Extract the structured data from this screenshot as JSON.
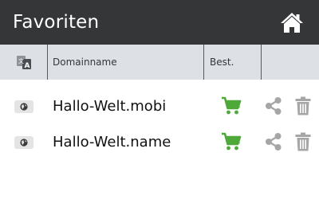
{
  "header": {
    "title": "Favoriten",
    "home_icon": "home-icon"
  },
  "table": {
    "columns": {
      "language_icon": "language-translate-icon",
      "domain": "Domainname",
      "order": "Best."
    },
    "rows": [
      {
        "domain": "Hallo-Welt.mobi",
        "tld_icon": "globe-icon",
        "actions": [
          "cart-icon",
          "share-icon",
          "trash-icon"
        ]
      },
      {
        "domain": "Hallo-Welt.name",
        "tld_icon": "globe-icon",
        "actions": [
          "cart-icon",
          "share-icon",
          "trash-icon"
        ]
      }
    ]
  },
  "colors": {
    "titlebar": "#353638",
    "header_bg": "#dde1e6",
    "cart": "#4ea83a",
    "muted_icon": "#a6a6a6"
  }
}
